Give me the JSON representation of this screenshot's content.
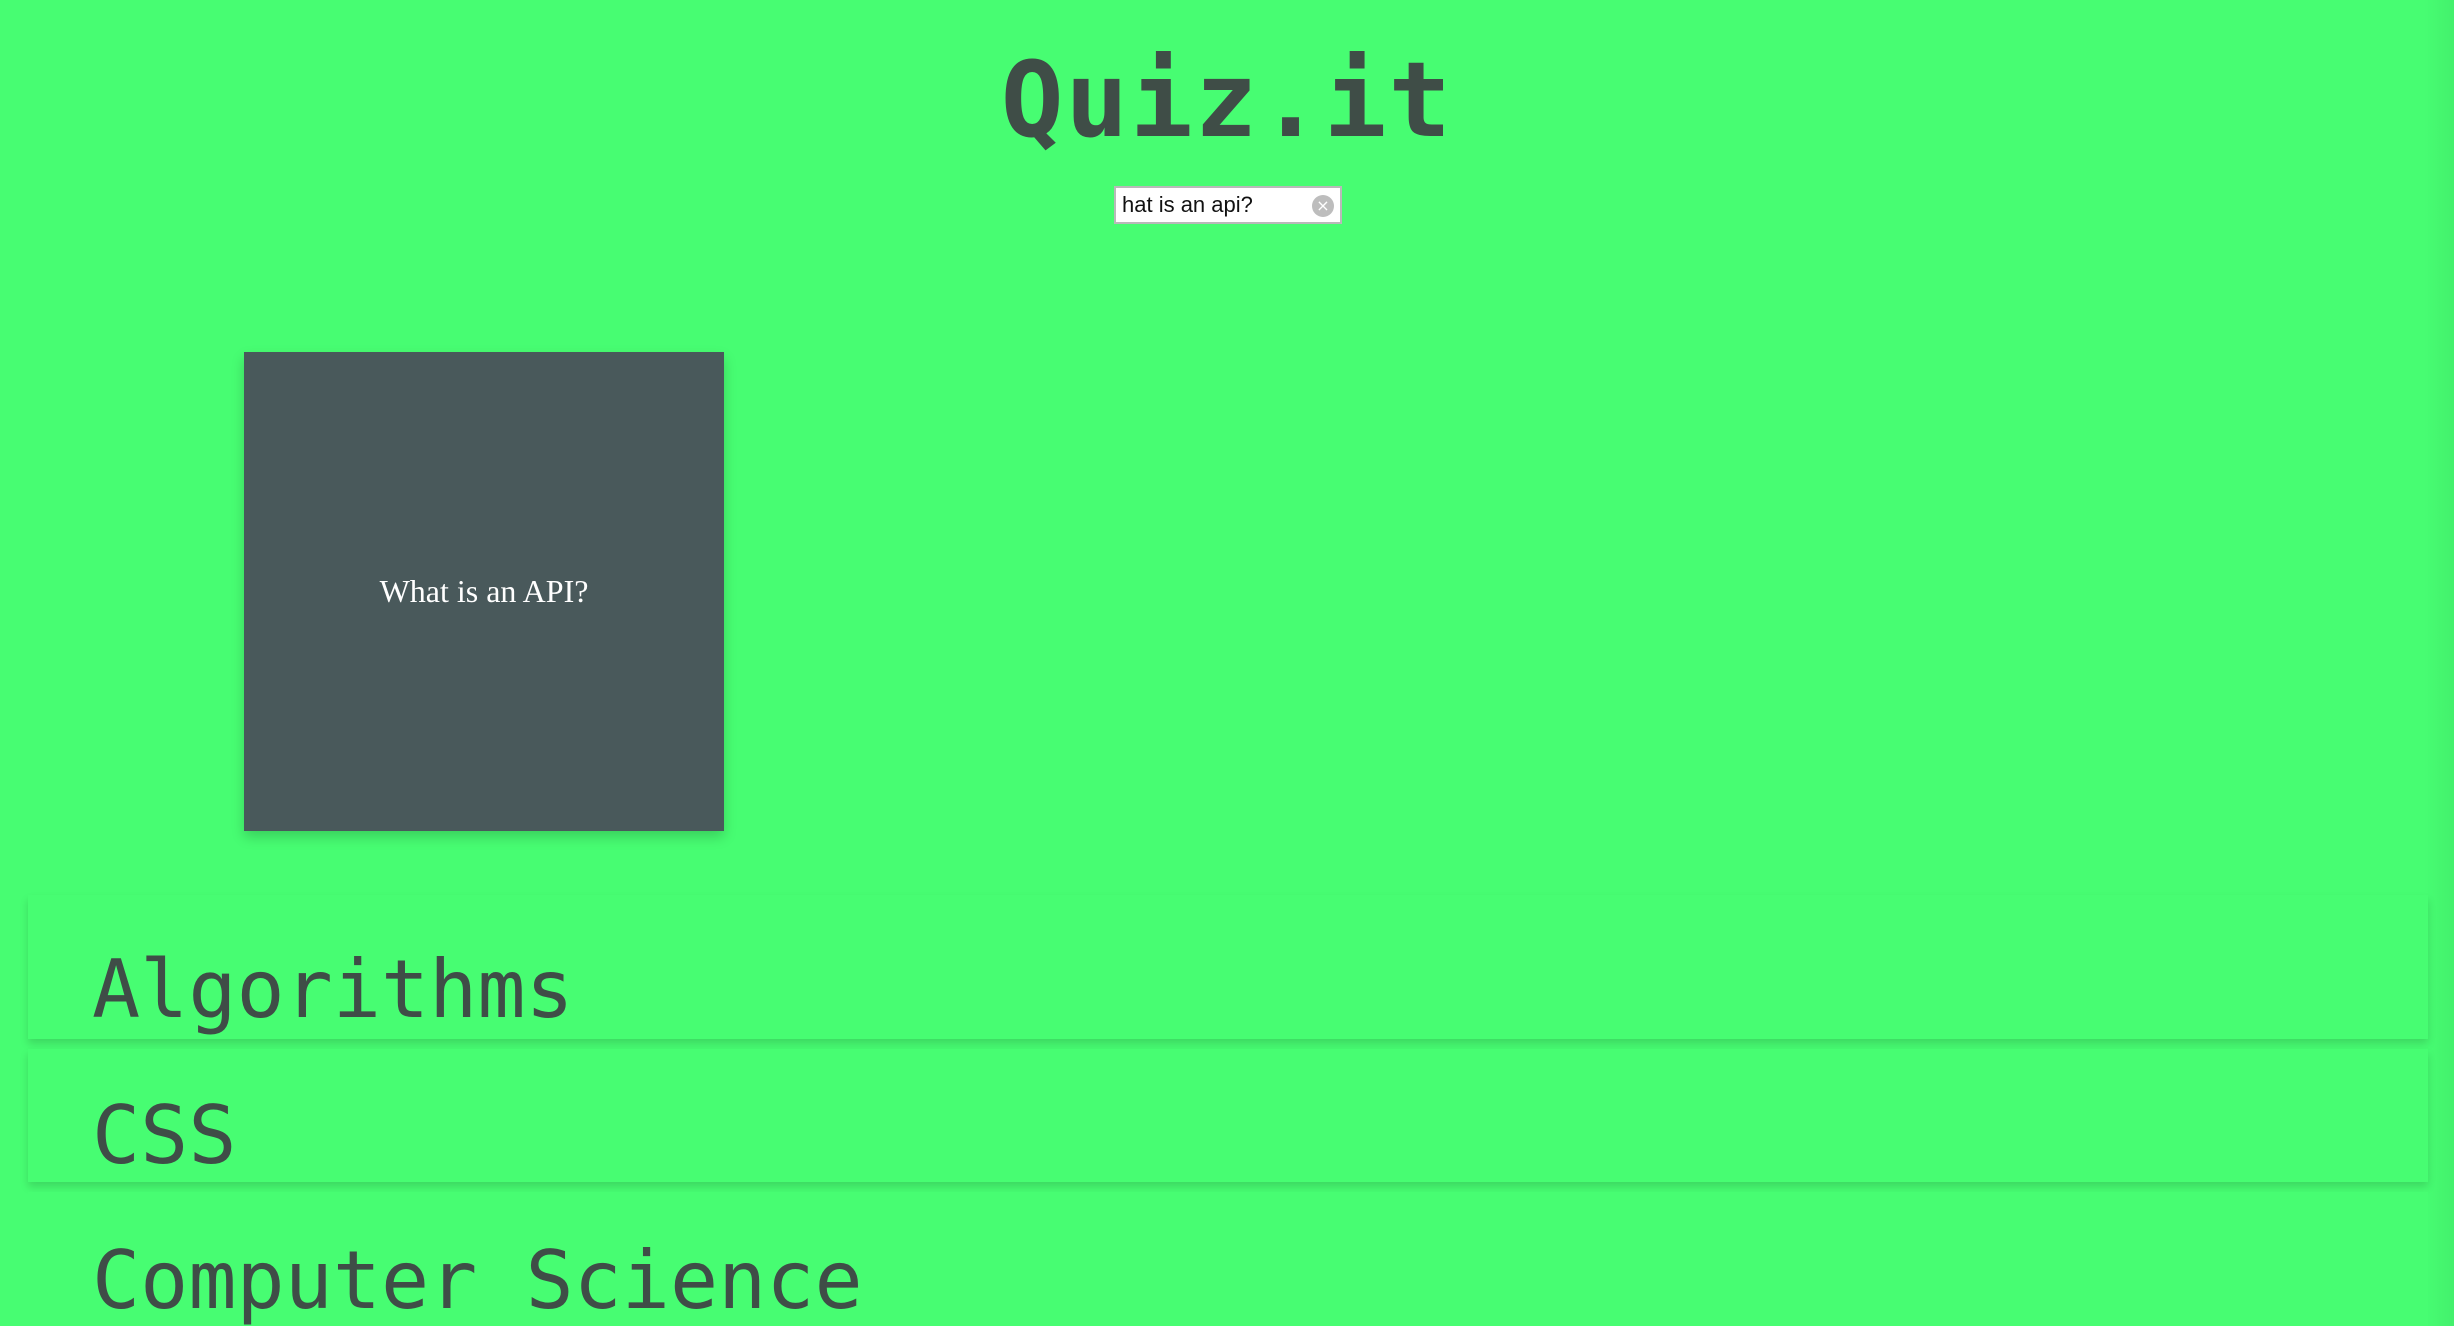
{
  "header": {
    "title": "Quiz.it"
  },
  "search": {
    "value": "hat is an api?",
    "clear_icon": "clear-circle-icon"
  },
  "results": [
    {
      "question": "What is an API?"
    }
  ],
  "categories": [
    {
      "label": "Algorithms"
    },
    {
      "label": "CSS"
    },
    {
      "label": "Computer Science"
    }
  ],
  "colors": {
    "background": "#47fd72",
    "card": "#49595b",
    "text_dark": "#3f4d47"
  }
}
